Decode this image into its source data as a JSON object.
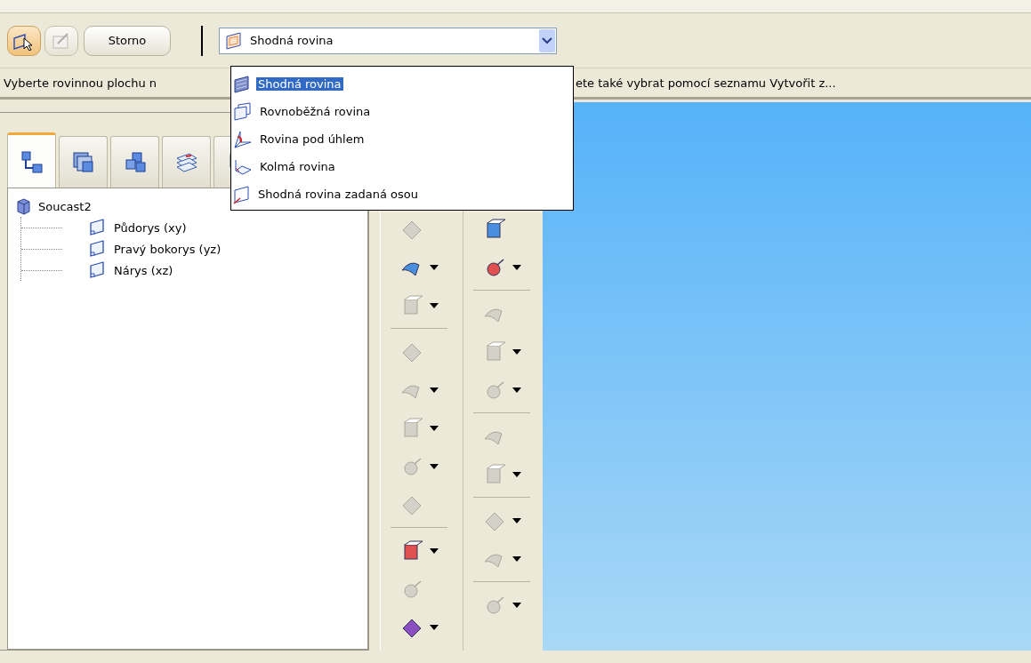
{
  "toolbar": {
    "buttons": [
      {
        "kind": "select",
        "selected": true,
        "disabled": false
      },
      {
        "kind": "edit",
        "selected": false,
        "disabled": true
      },
      {
        "kind": "text",
        "label": "Storno",
        "selected": false,
        "disabled": false
      }
    ],
    "combo": {
      "value": "Shodná rovina",
      "expanded": true
    }
  },
  "dropdown": {
    "items": [
      {
        "label": "Shodná rovina",
        "kind": "coincident",
        "selected": true
      },
      {
        "label": "Rovnoběžná rovina",
        "kind": "parallel",
        "selected": false
      },
      {
        "label": "Rovina pod úhlem",
        "kind": "angle",
        "selected": false
      },
      {
        "label": "Kolmá rovina",
        "kind": "normal",
        "selected": false
      },
      {
        "label": "Shodná rovina zadaná osou",
        "kind": "axis",
        "selected": false
      }
    ]
  },
  "status_bar": {
    "text_left": "Vyberte rovinnou plochu n",
    "text_right": "ete také vybrat pomocí seznamu Vytvořit z..."
  },
  "tabs": [
    {
      "kind": "tree",
      "selected": true
    },
    {
      "kind": "layers",
      "selected": false
    },
    {
      "kind": "blocks",
      "selected": false
    },
    {
      "kind": "sheets",
      "selected": false
    },
    {
      "kind": "other",
      "selected": false
    }
  ],
  "tree": {
    "items": [
      {
        "label": "Soucast2",
        "kind": "part",
        "children": [
          {
            "label": "Půdorys (xy)",
            "kind": "plane"
          },
          {
            "label": "Pravý bokorys (yz)",
            "kind": "plane"
          },
          {
            "label": "Nárys (xz)",
            "kind": "plane"
          }
        ]
      }
    ]
  },
  "tool_columns": [
    [
      {
        "kind": "tool",
        "disabled": true,
        "has_menu": false
      },
      {
        "kind": "tool",
        "disabled": false,
        "has_menu": true
      },
      {
        "kind": "tool",
        "disabled": true,
        "has_menu": true
      },
      {
        "kind": "separator"
      },
      {
        "kind": "tool",
        "disabled": true,
        "has_menu": false
      },
      {
        "kind": "tool",
        "disabled": true,
        "has_menu": true
      },
      {
        "kind": "tool",
        "disabled": true,
        "has_menu": true
      },
      {
        "kind": "tool",
        "disabled": true,
        "has_menu": true
      },
      {
        "kind": "tool",
        "disabled": true,
        "has_menu": false
      },
      {
        "kind": "separator"
      },
      {
        "kind": "tool",
        "disabled": false,
        "has_menu": true
      },
      {
        "kind": "tool",
        "disabled": true,
        "has_menu": false
      },
      {
        "kind": "tool",
        "disabled": false,
        "has_menu": true
      }
    ],
    [
      {
        "kind": "tool",
        "disabled": false,
        "has_menu": false
      },
      {
        "kind": "tool",
        "disabled": false,
        "has_menu": true
      },
      {
        "kind": "separator"
      },
      {
        "kind": "tool",
        "disabled": true,
        "has_menu": false
      },
      {
        "kind": "tool",
        "disabled": true,
        "has_menu": true
      },
      {
        "kind": "tool",
        "disabled": true,
        "has_menu": true
      },
      {
        "kind": "separator"
      },
      {
        "kind": "tool",
        "disabled": true,
        "has_menu": false
      },
      {
        "kind": "tool",
        "disabled": true,
        "has_menu": true
      },
      {
        "kind": "separator"
      },
      {
        "kind": "tool",
        "disabled": true,
        "has_menu": true
      },
      {
        "kind": "tool",
        "disabled": true,
        "has_menu": true
      },
      {
        "kind": "separator"
      },
      {
        "kind": "tool",
        "disabled": true,
        "has_menu": true
      }
    ]
  ]
}
